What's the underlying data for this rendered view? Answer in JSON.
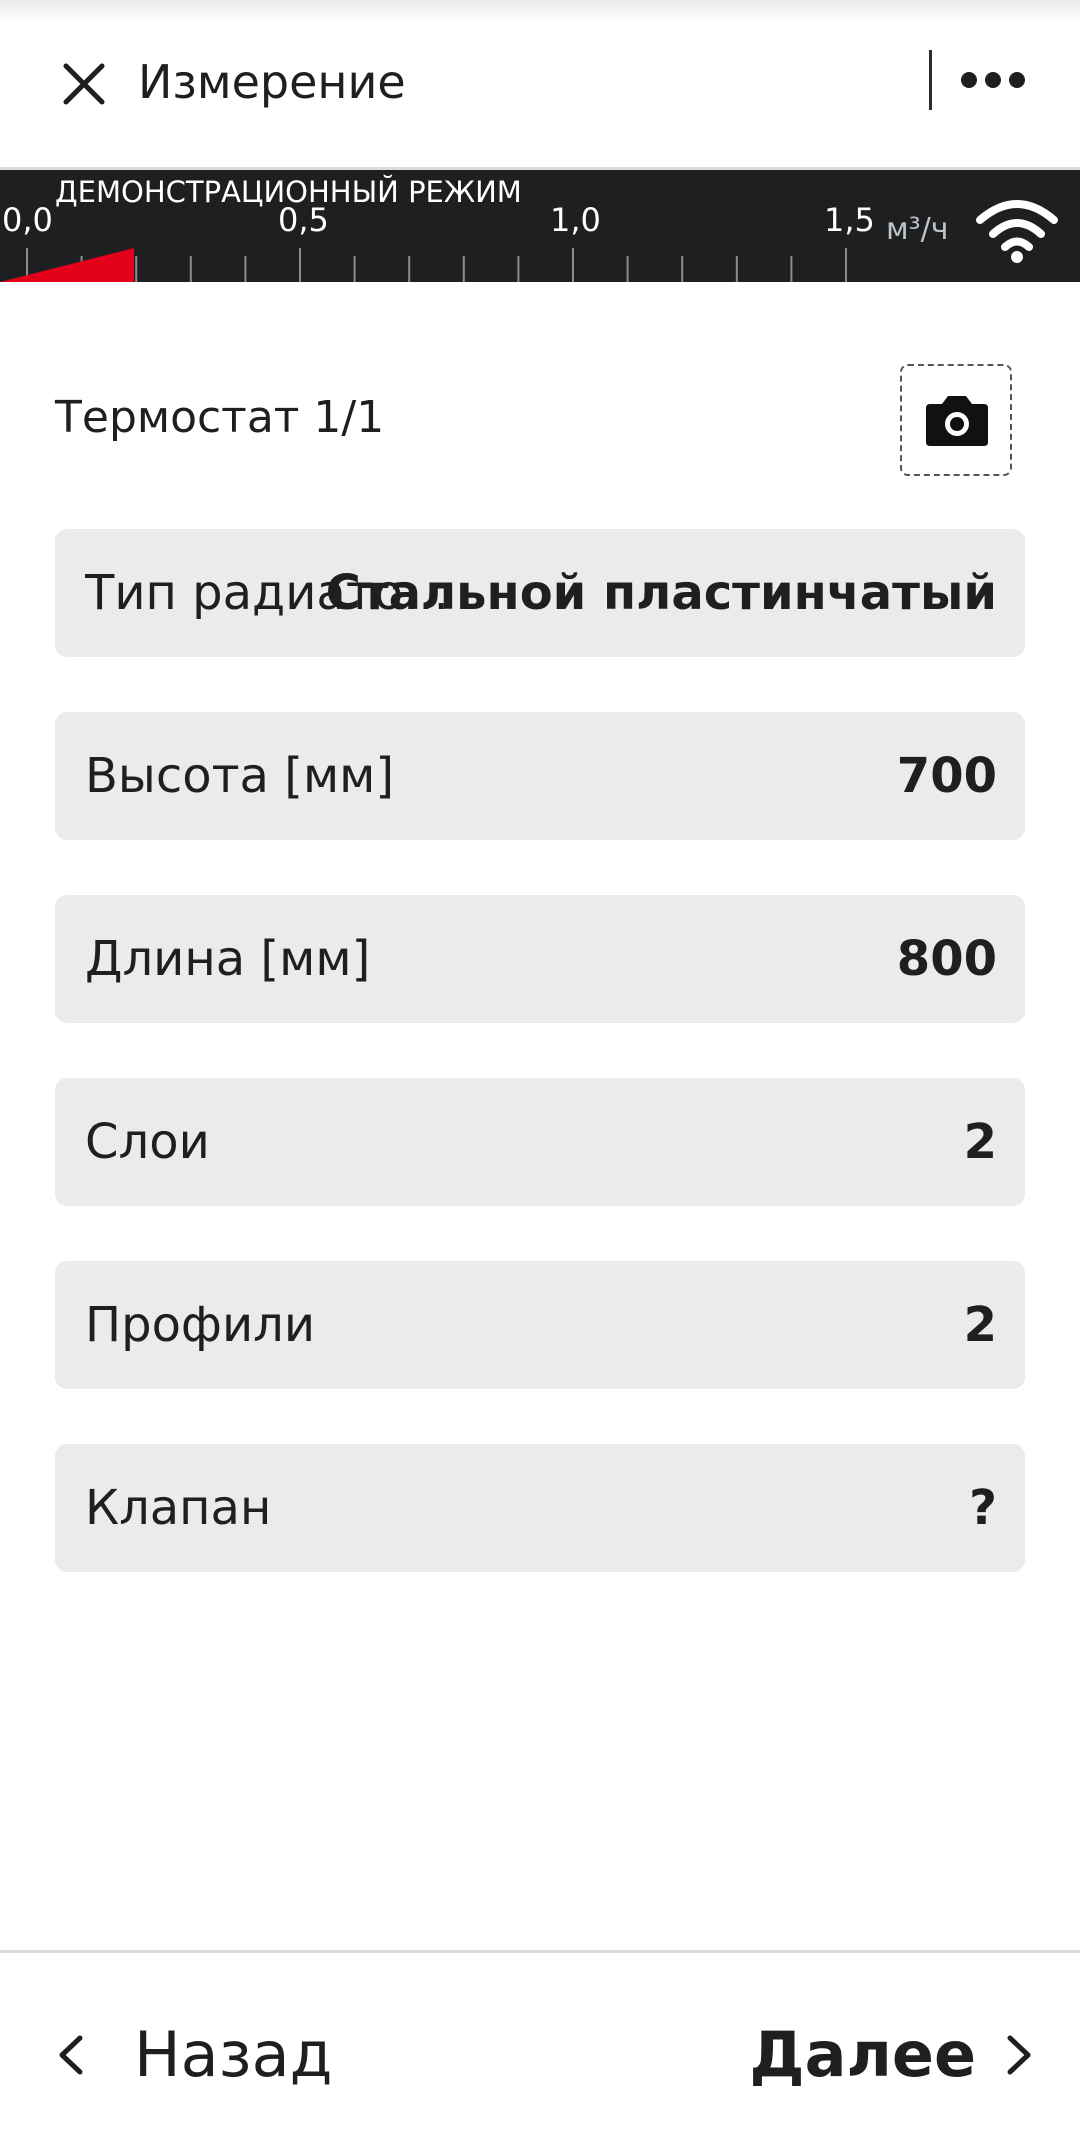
{
  "header": {
    "title": "Измерение",
    "close_icon": "close-icon",
    "more_icon": "more-horizontal-icon"
  },
  "flow_bar": {
    "mode_label": "ДЕМОНСТРАЦИОННЫЙ РЕЖИМ",
    "scale_labels": [
      "0,0",
      "0,5",
      "1,0",
      "1,5"
    ],
    "unit": "м³/ч",
    "current_fill_fraction": 0.06,
    "fill_color": "#e2001a",
    "wifi_icon": "wifi-icon"
  },
  "section": {
    "title": "Термостат 1/1",
    "camera_icon": "camera-icon"
  },
  "rows": [
    {
      "label": "Тип радиато...",
      "value": "Стальной пластинчатый"
    },
    {
      "label": "Высота [мм]",
      "value": "700"
    },
    {
      "label": "Длина [мм]",
      "value": "800"
    },
    {
      "label": "Слои",
      "value": "2"
    },
    {
      "label": "Профили",
      "value": "2"
    },
    {
      "label": "Клапан",
      "value": "?"
    }
  ],
  "footer": {
    "back_label": "Назад",
    "next_label": "Далее"
  },
  "colors": {
    "accent": "#e2001a",
    "dark": "#1d1f21",
    "row_bg": "#eaebeb"
  }
}
